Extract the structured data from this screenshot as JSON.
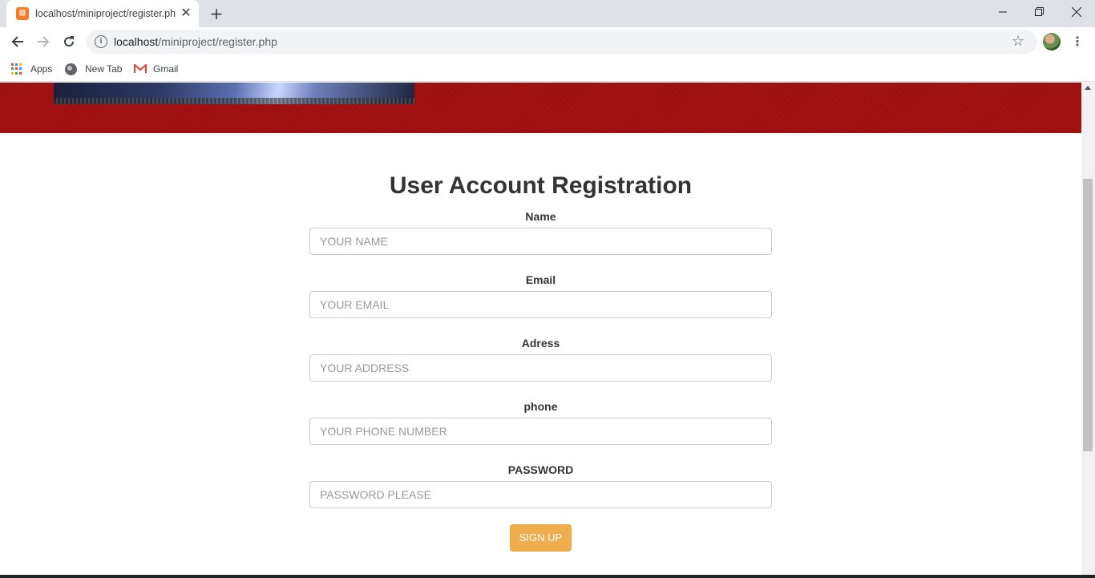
{
  "browser": {
    "tab_title": "localhost/miniproject/register.php",
    "url_host": "localhost",
    "url_path": "/miniproject/register.php",
    "bookmarks": [
      {
        "label": "Apps"
      },
      {
        "label": "New Tab"
      },
      {
        "label": "Gmail"
      }
    ]
  },
  "page": {
    "title": "User Account Registration",
    "fields": [
      {
        "label": "Name",
        "placeholder": "YOUR NAME"
      },
      {
        "label": "Email",
        "placeholder": "YOUR EMAIL"
      },
      {
        "label": "Adress",
        "placeholder": "YOUR ADDRESS"
      },
      {
        "label": "phone",
        "placeholder": "YOUR PHONE NUMBER"
      },
      {
        "label": "PASSWORD",
        "placeholder": "PASSWORD PLEASE"
      }
    ],
    "submit_label": "SIGN UP"
  },
  "colors": {
    "header_bg": "#a30d0d",
    "button_bg": "#f0ad4e",
    "favicon": "#fb7a24"
  }
}
